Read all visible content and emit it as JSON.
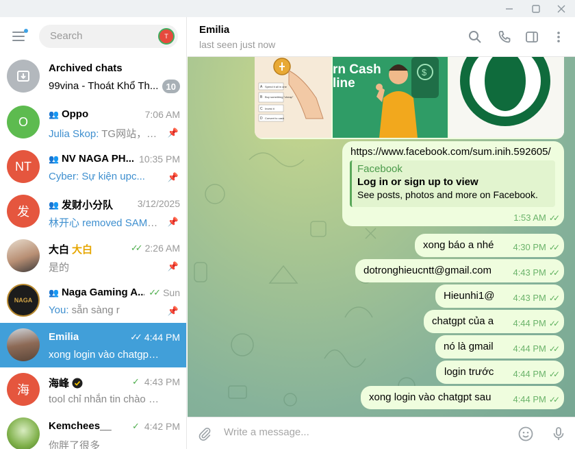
{
  "window": {
    "min": "—",
    "max": "☐",
    "close": "✕"
  },
  "sidebar": {
    "search_placeholder": "Search",
    "search_avatar": "T",
    "chats": [
      {
        "name": "Archived chats",
        "preview": "99vina - Thoát Khổ Th...",
        "badge": "10",
        "avatar_color": "#b3b8bd",
        "avatar_text": ""
      },
      {
        "name": "Oppo",
        "time": "7:06 AM",
        "sender": "Julia Skop:",
        "preview": " TG网站，我...",
        "avatar_color": "#5dbb4f",
        "avatar_text": "O"
      },
      {
        "name": "NV NAGA PH...",
        "time": "10:35 PM",
        "sender": "Cyber:",
        "preview": " Sự kiện upc...",
        "avatar_color": "#e5563e",
        "avatar_text": "NT"
      },
      {
        "name": "发财小分队",
        "time": "3/12/2025",
        "sender": "林开心 removed SAMA...",
        "preview": "",
        "avatar_color": "#e5563e",
        "avatar_text": "发"
      },
      {
        "name": "大白",
        "name_suffix": "大白",
        "time": "2:26 AM",
        "preview": "是的",
        "avatar_color": "#c9a383",
        "avatar_text": ""
      },
      {
        "name": "Naga Gaming A...",
        "time": "Sun",
        "sender": "You:",
        "preview": " sẵn sàng r",
        "avatar_color": "#1c1c1c",
        "avatar_text": "NAGA"
      },
      {
        "name": "Emilia",
        "time": "4:44 PM",
        "preview": "xong login  vào chatgpt sau",
        "avatar_color": "#8a6a57",
        "avatar_text": ""
      },
      {
        "name": "海峰",
        "time": "4:43 PM",
        "preview": "tool chỉ nhắn tin chào mừ...",
        "avatar_color": "#e5563e",
        "avatar_text": "海"
      },
      {
        "name": "Kemchees__",
        "time": "4:42 PM",
        "preview": "你胖了很多",
        "avatar_color": "#7fb04a",
        "avatar_text": ""
      }
    ]
  },
  "header": {
    "title": "Emilia",
    "status": "last seen just now"
  },
  "messages": {
    "link_message": {
      "url": "https://www.facebook.com/sum.inih.592605/",
      "preview_site": "Facebook",
      "preview_title": "Log in or sign up to view",
      "preview_desc": "See posts, photos and more on Facebook.",
      "time": "1:53 AM"
    },
    "list": [
      {
        "text": "xong báo a nhé",
        "time": "4:30 PM",
        "link": false
      },
      {
        "text": "dotronghieucntt@gmail.com",
        "time": "4:43 PM",
        "link": true
      },
      {
        "text": "Hieunhi1@",
        "time": "4:43 PM",
        "link": false
      },
      {
        "text": "chatgpt của a",
        "time": "4:44 PM",
        "link": false
      },
      {
        "text": "nó là gmail",
        "time": "4:44 PM",
        "link": false
      },
      {
        "text": "login trước",
        "time": "4:44 PM",
        "link": false
      },
      {
        "text": "xong login  vào chatgpt sau",
        "time": "4:44 PM",
        "link": false
      }
    ],
    "image_text": {
      "steps": [
        "Spend it all in one",
        "Buy something \"cheap\"",
        "Invest it",
        "Convert to cash"
      ],
      "poster": "rn Cash\nline"
    }
  },
  "compose": {
    "placeholder": "Write a message..."
  },
  "colors": {
    "accent": "#419fd9",
    "bubble": "#effdde",
    "check": "#5fb15e"
  }
}
